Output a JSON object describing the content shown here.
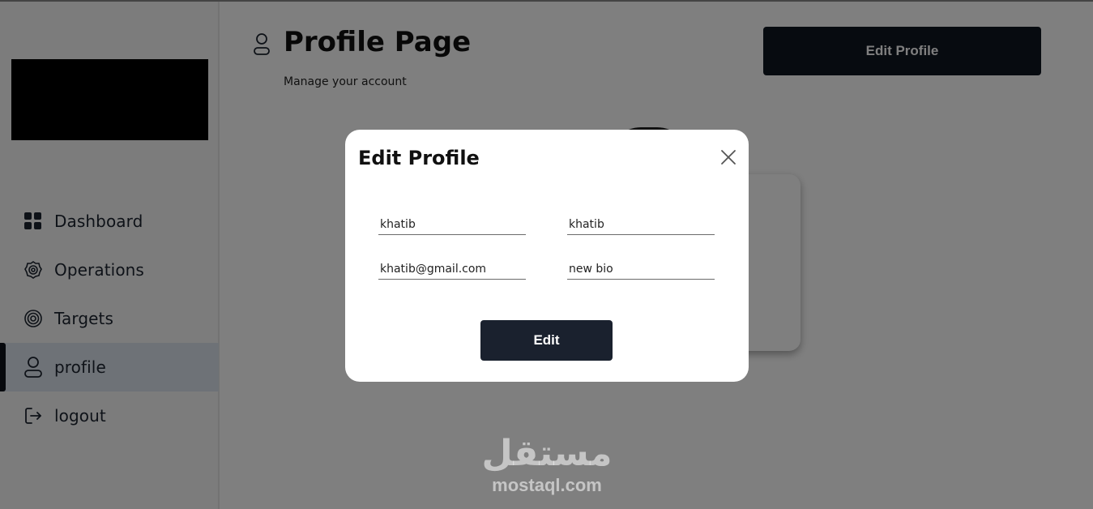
{
  "sidebar": {
    "items": [
      {
        "label": "Dashboard",
        "icon": "grid-icon"
      },
      {
        "label": "Operations",
        "icon": "badge-icon"
      },
      {
        "label": "Targets",
        "icon": "target-icon"
      },
      {
        "label": "profile",
        "icon": "user-icon",
        "active": true
      },
      {
        "label": "logout",
        "icon": "logout-icon"
      }
    ]
  },
  "header": {
    "title": "Profile Page",
    "subtitle": "Manage your account",
    "edit_profile_label": "Edit Profile"
  },
  "modal": {
    "title": "Edit Profile",
    "fields": {
      "first_name": "khatib",
      "last_name": "khatib",
      "email": "khatib@gmail.com",
      "bio": "new bio"
    },
    "submit_label": "Edit"
  },
  "watermark": {
    "arabic": "مستقل",
    "latin": "mostaql.com"
  },
  "colors": {
    "primary_dark": "#0f1621",
    "active_nav_bg": "#dde4ef",
    "overlay": "rgba(0,0,0,0.5)"
  }
}
